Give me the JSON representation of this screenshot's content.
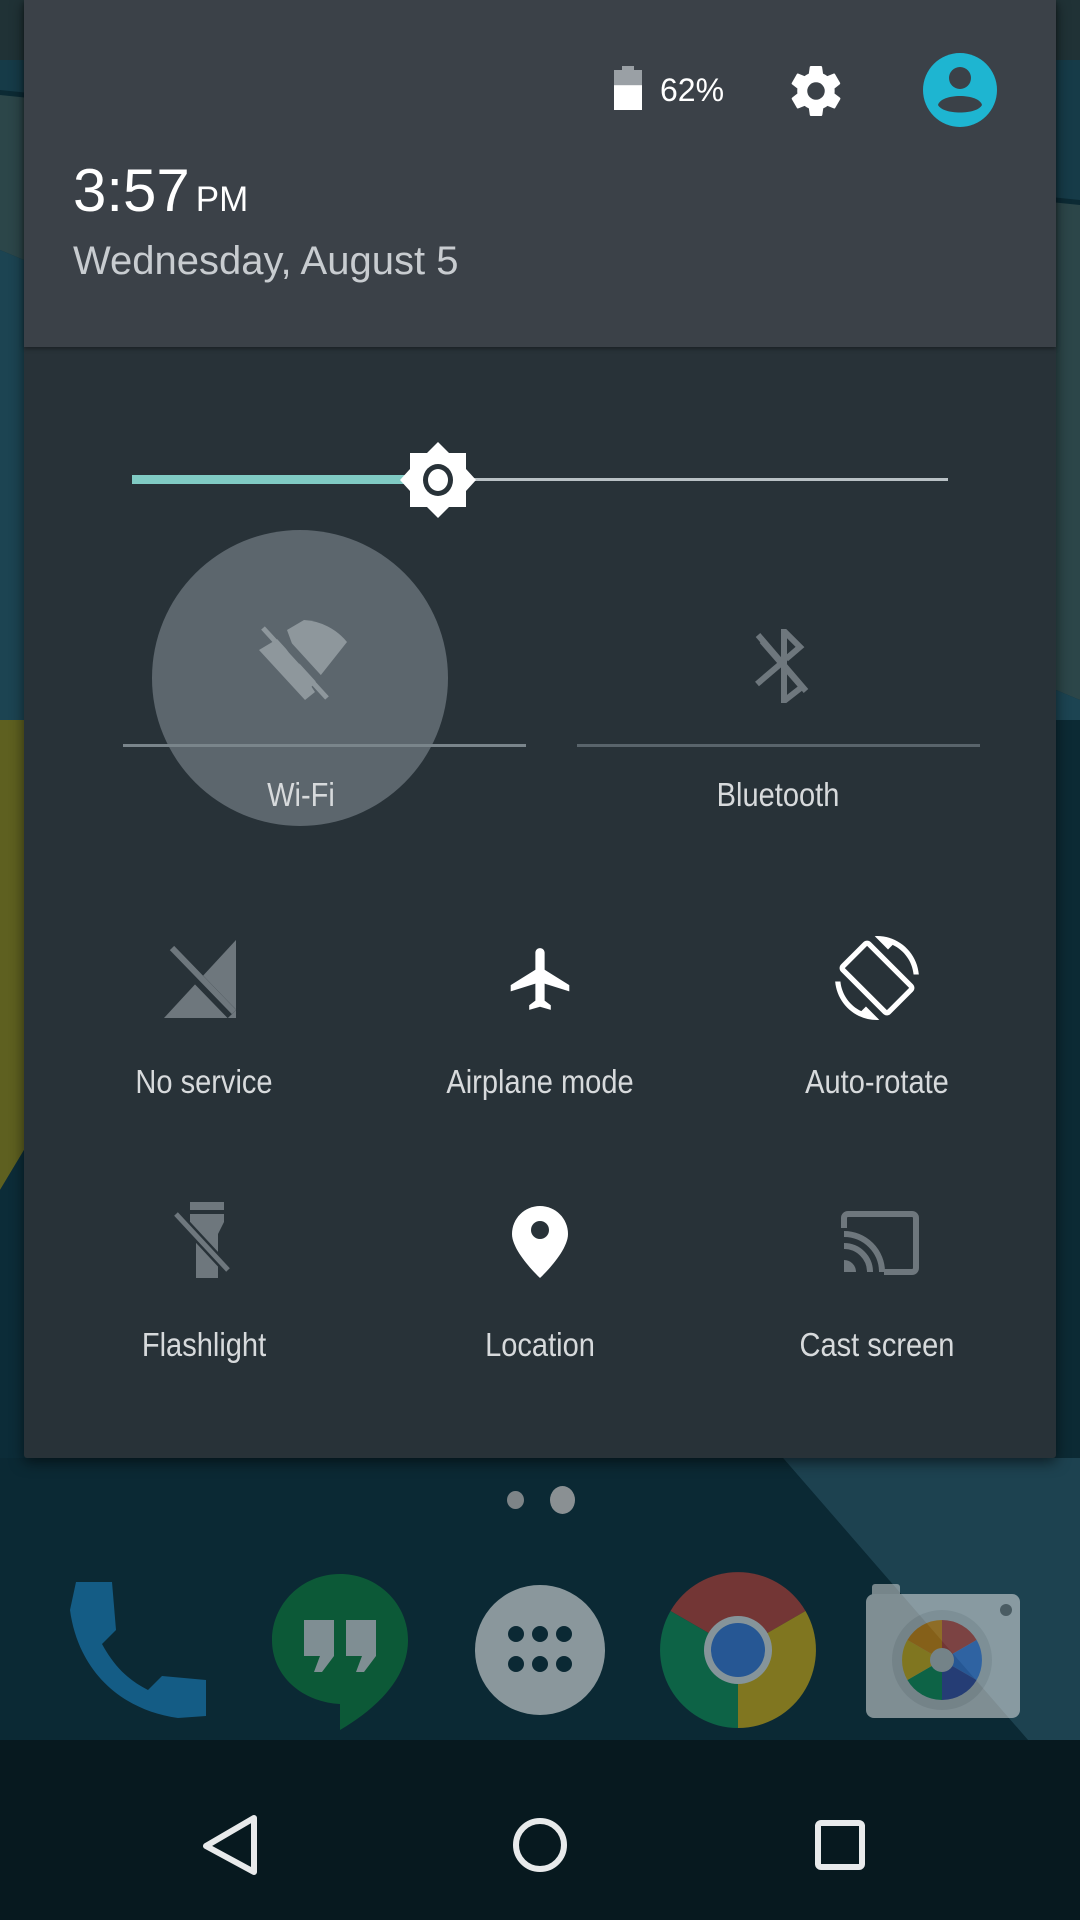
{
  "status": {
    "battery_percent_text": "62%",
    "battery_level": 0.62,
    "icons": {
      "battery": "battery-icon",
      "settings": "gear-icon",
      "user": "user-avatar-icon"
    }
  },
  "header": {
    "time": "3:57",
    "ampm": "PM",
    "date": "Wednesday, August 5"
  },
  "brightness": {
    "level": 0.375,
    "icon": "brightness-icon",
    "accent_color": "#80cbc4"
  },
  "tiles": [
    {
      "label": "Wi-Fi",
      "icon": "wifi-off-icon",
      "state": "off",
      "pressed": true
    },
    {
      "label": "Bluetooth",
      "icon": "bluetooth-off-icon",
      "state": "off"
    },
    {
      "label": "No service",
      "icon": "no-signal-icon",
      "state": "off"
    },
    {
      "label": "Airplane mode",
      "icon": "airplane-icon",
      "state": "on"
    },
    {
      "label": "Auto-rotate",
      "icon": "screen-rotation-icon",
      "state": "on"
    },
    {
      "label": "Flashlight",
      "icon": "flashlight-off-icon",
      "state": "off"
    },
    {
      "label": "Location",
      "icon": "location-pin-icon",
      "state": "on"
    },
    {
      "label": "Cast screen",
      "icon": "cast-icon",
      "state": "off"
    }
  ],
  "home": {
    "page_count": 2,
    "current_page": 2,
    "dock": [
      {
        "app": "Phone",
        "icon": "phone-icon"
      },
      {
        "app": "Hangouts",
        "icon": "hangouts-icon"
      },
      {
        "app": "App drawer",
        "icon": "app-drawer-icon"
      },
      {
        "app": "Chrome",
        "icon": "chrome-icon"
      },
      {
        "app": "Camera",
        "icon": "camera-icon"
      }
    ]
  },
  "navbar": {
    "back": "back-icon",
    "home": "home-icon",
    "recents": "recents-icon"
  },
  "colors": {
    "header_bg": "#3b4148",
    "panel_bg": "#283238",
    "avatar": "#1eb5d1",
    "active_icon": "#ffffff",
    "inactive_icon": "#6e777d"
  }
}
